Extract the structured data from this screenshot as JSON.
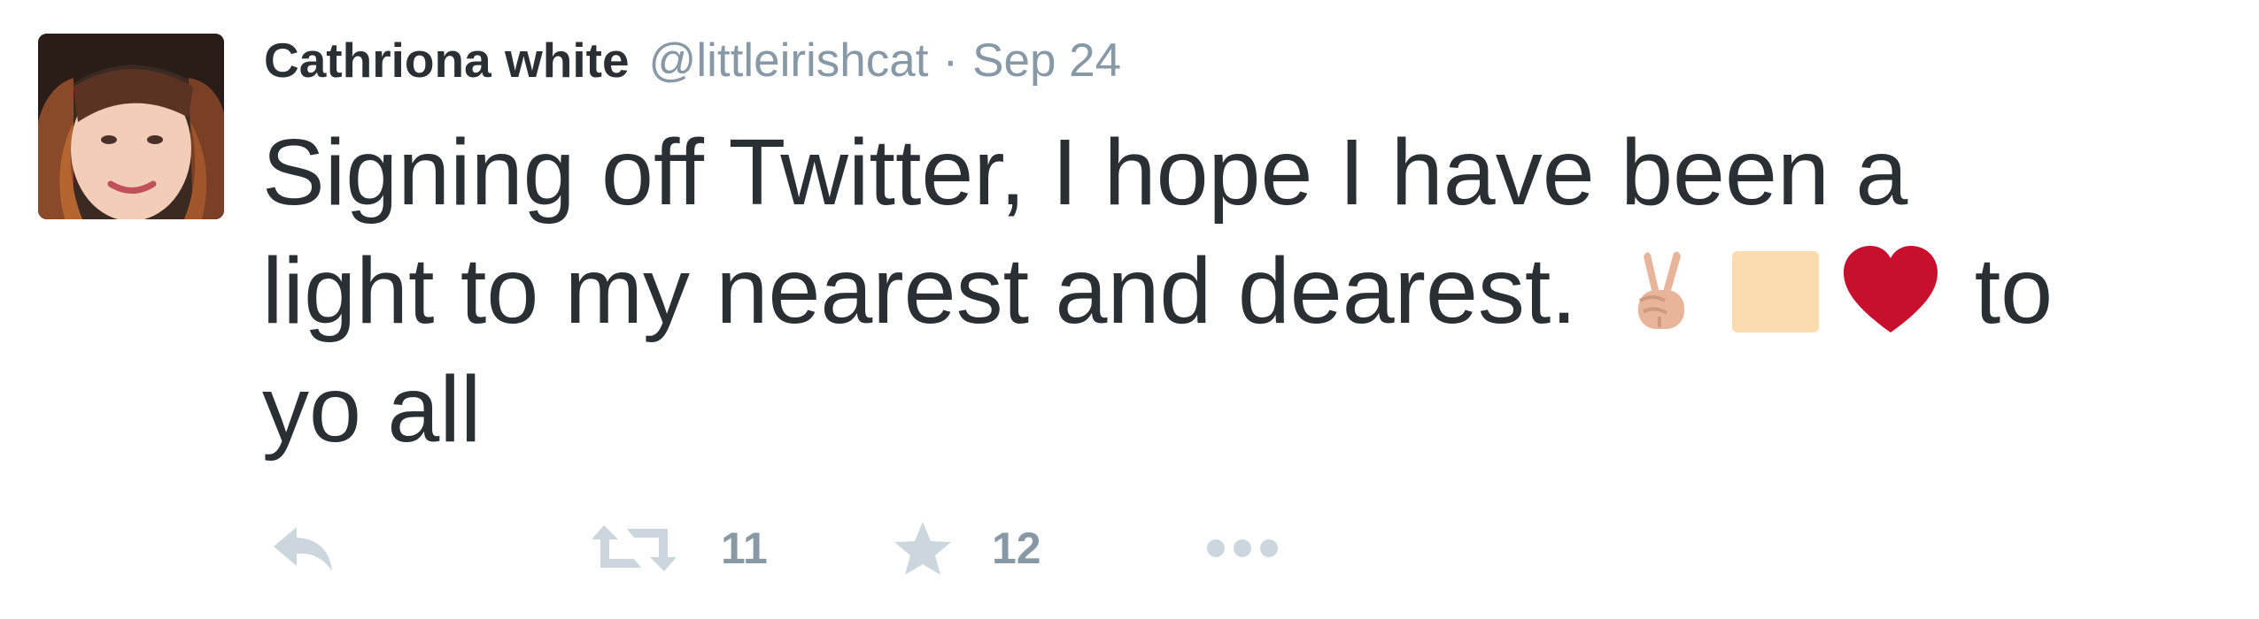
{
  "author": {
    "fullname": "Cathriona white",
    "username": "@littleirishcat",
    "separator": "·",
    "timestamp": "Sep 24"
  },
  "tweet": {
    "line1": "Signing off Twitter, I hope I have been a",
    "line2_start": "light to my nearest and dearest.",
    "line2_end": "to",
    "line3": "yo all",
    "emojis": [
      "victory-hand-icon",
      "skin-tone-modifier-icon",
      "red-heart-icon"
    ]
  },
  "actions": {
    "retweet_count": "11",
    "favorite_count": "12"
  },
  "colors": {
    "text": "#292f33",
    "meta": "#8899a6",
    "action_icon": "#ccd6dd",
    "heart": "#dd2e44"
  }
}
